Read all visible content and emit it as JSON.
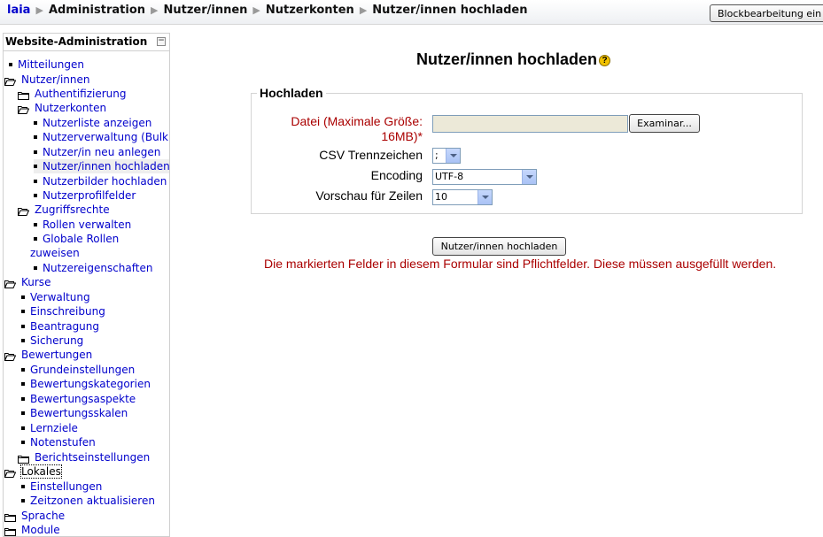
{
  "navbar": {
    "home": "laia",
    "crumbs": [
      "Administration",
      "Nutzer/innen",
      "Nutzerkonten",
      "Nutzer/innen hochladen"
    ],
    "block_edit_button": "Blockbearbeitung ein"
  },
  "sidebar": {
    "title": "Website-Administration",
    "items": [
      {
        "label": "Mitteilungen",
        "icon": "bullet"
      },
      {
        "label": "Nutzer/innen",
        "icon": "folder-open"
      },
      {
        "label": "Authentifizierung",
        "icon": "folder-closed"
      },
      {
        "label": "Nutzerkonten",
        "icon": "folder-open"
      },
      {
        "label": "Nutzerliste anzeigen",
        "icon": "bullet"
      },
      {
        "label": "Nutzerverwaltung (Bulk)",
        "icon": "bullet"
      },
      {
        "label": "Nutzer/in neu anlegen",
        "icon": "bullet"
      },
      {
        "label": "Nutzer/innen hochladen",
        "icon": "bullet",
        "active": true
      },
      {
        "label": "Nutzerbilder hochladen",
        "icon": "bullet"
      },
      {
        "label": "Nutzerprofilfelder",
        "icon": "bullet"
      },
      {
        "label": "Zugriffsrechte",
        "icon": "folder-open"
      },
      {
        "label": "Rollen verwalten",
        "icon": "bullet"
      },
      {
        "label": "Globale Rollen",
        "icon": "bullet"
      },
      {
        "label": "zuweisen",
        "icon": "none"
      },
      {
        "label": "Nutzereigenschaften",
        "icon": "bullet"
      },
      {
        "label": "Kurse",
        "icon": "folder-open"
      },
      {
        "label": "Verwaltung",
        "icon": "bullet"
      },
      {
        "label": "Einschreibung",
        "icon": "bullet"
      },
      {
        "label": "Beantragung",
        "icon": "bullet"
      },
      {
        "label": "Sicherung",
        "icon": "bullet"
      },
      {
        "label": "Bewertungen",
        "icon": "folder-open"
      },
      {
        "label": "Grundeinstellungen",
        "icon": "bullet"
      },
      {
        "label": "Bewertungskategorien",
        "icon": "bullet"
      },
      {
        "label": "Bewertungsaspekte",
        "icon": "bullet"
      },
      {
        "label": "Bewertungsskalen",
        "icon": "bullet"
      },
      {
        "label": "Lernziele",
        "icon": "bullet"
      },
      {
        "label": "Notenstufen",
        "icon": "bullet"
      },
      {
        "label": "Berichtseinstellungen",
        "icon": "folder-closed"
      },
      {
        "label": "Lokales",
        "icon": "folder-open",
        "focus": true
      },
      {
        "label": "Einstellungen",
        "icon": "bullet"
      },
      {
        "label": "Zeitzonen aktualisieren",
        "icon": "bullet"
      },
      {
        "label": "Sprache",
        "icon": "folder-closed"
      },
      {
        "label": "Module",
        "icon": "folder-closed"
      }
    ]
  },
  "main": {
    "title": "Nutzer/innen hochladen",
    "help_icon_glyph": "?",
    "fieldset_legend": "Hochladen",
    "file_label_line1": "Datei (Maximale Größe:",
    "file_label_line2": "16MB)",
    "required_marker": "*",
    "browse_button": "Examinar...",
    "csv_label": "CSV Trennzeichen",
    "csv_value": ";",
    "encoding_label": "Encoding",
    "encoding_value": "UTF-8",
    "preview_label": "Vorschau für Zeilen",
    "preview_value": "10",
    "submit_button": "Nutzer/innen hochladen",
    "required_note": "Die markierten Felder in diesem Formular sind Pflichtfelder. Diese müssen ausgefüllt werden."
  },
  "colors": {
    "link": "#0000cc",
    "required": "#aa0000",
    "help_icon": "#f2c200"
  }
}
